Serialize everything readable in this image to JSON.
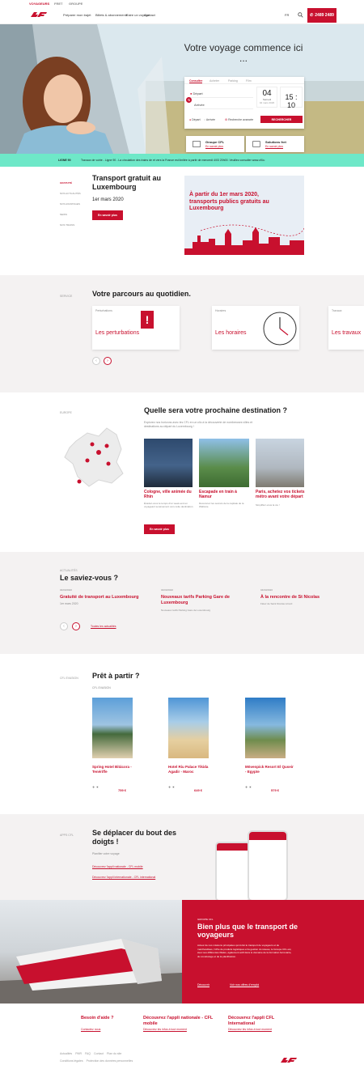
{
  "topbar": {
    "items": [
      "VOYAGEURS",
      "FRET",
      "GROUPE"
    ]
  },
  "nav": {
    "items": [
      "Préparer mon trajet",
      "Billets & abonnements",
      "Faire un voyage",
      "Entreprise",
      "Contact"
    ],
    "lang": "FR",
    "phone": "2489 2489"
  },
  "hero": {
    "title": "Votre voyage commence ici ...",
    "tabs": [
      "Consulter",
      "Acheter",
      "Parking",
      "Film"
    ],
    "from_placeholder": "Départ",
    "to_placeholder": "Arrivée",
    "day": "04",
    "weekday": "Samedi",
    "date_sub": "04 mars 2020",
    "time": "15 : 10",
    "options": [
      "Départ",
      "Arrivée",
      "Recherche avancée"
    ],
    "search_label": "RECHERCHER",
    "card1_title": "Groupe CFL",
    "card1_link": "En savoir plus",
    "card2_title": "Solutions fret",
    "card2_link": "En savoir plus"
  },
  "ticker": {
    "label": "LIGNE 90",
    "text": "Travaux de voirie - Ligne 90 - La circulation des trains de et vers la France est limitée à partir de mercredi 4/03 20h00. Veuillez consulter www.cfl.lu"
  },
  "news_tabs": [
    "GRATUITÉ",
    "NOS ACTUALITÉS",
    "NOS AVANTAGES",
    "NEWS",
    "NOS TRAINS"
  ],
  "featured": {
    "title": "Transport gratuit au Luxembourg",
    "date": "1er mars 2020",
    "button": "En savoir plus",
    "banner_text": "À partir du 1er mars 2020, transports publics gratuits au Luxembourg"
  },
  "parcours": {
    "label": "SERVICE",
    "title": "Votre parcours au quotidien.",
    "tiles": [
      {
        "tag": "Perturbations",
        "label": "Les perturbations"
      },
      {
        "tag": "Horaires",
        "label": "Les horaires"
      },
      {
        "tag": "Travaux",
        "label": "Les travaux"
      }
    ]
  },
  "destination": {
    "label": "EUROPE",
    "title": "Quelle sera votre prochaine destination ?",
    "intro": "Explorez nos horizons avec les CFL en un clic à la découverte de nombreuses villes et destinations au départ du Luxembourg !",
    "cards": [
      {
        "title": "Cologne, ville animée du Rhin",
        "desc": "Évadez-vous le temps d'un week-end en voyageant sereinement vers cette destination."
      },
      {
        "title": "Escapade en train à Namur",
        "desc": "Découvrez les secrets de la capitale de la Wallonie."
      },
      {
        "title": "Paris, achetez vos tickets métro avant votre départ",
        "desc": "Simplifiez-vous la vie !"
      }
    ],
    "button": "En savoir plus"
  },
  "saviez": {
    "label": "ACTUALITÉS",
    "title": "Le saviez-vous ?",
    "items": [
      {
        "date": "04/03/2020",
        "title": "Gratuité de transport au Luxembourg",
        "desc": "1er mars 2020"
      },
      {
        "date": "04/03/2020",
        "title": "Nouveaux tarifs Parking Gare de Luxembourg",
        "desc": "Nouveaux tarifs Parking Gare de Luxembourg"
      },
      {
        "date": "04/03/2020",
        "title": "À la rencontre de St Nicolas",
        "desc": "Fêtez de Saint Nicolas à bord"
      }
    ],
    "all_link": "Toutes les actualités"
  },
  "pret": {
    "label": "CFL EVASION",
    "title": "Prêt à partir ?",
    "sub": "CFL EVASION",
    "hotels": [
      {
        "title": "Spring Hotel Bitácora - Tenériffe",
        "price": "759 €"
      },
      {
        "title": "Hotel Riu Palace Tikida Agadir - Maroc",
        "price": "649 €"
      },
      {
        "title": "Mövenpick Resort El Quseir - Egypte",
        "price": "579 €"
      }
    ]
  },
  "app": {
    "label": "APPS CFL",
    "title": "Se déplacer du bout des doigts !",
    "sub": "Planifier votre voyage",
    "link1": "Découvrez l'appli nationale - CFL mobile",
    "link2": "Découvrez l'appli internationale - CFL international"
  },
  "groupe": {
    "label": "GROUPE CFL",
    "title": "Bien plus que le transport de voyageurs",
    "text": "Acteur de nos missions principales qui inclut le transport de voyageurs et de marchandises, l'offre de produits logistiques et la gestion du réseau, le Groupe CFL est, avec ses différentes filiales, également actif dans le domaine de la formation ferroviaire, du covoiturage et de la planification.",
    "link1": "Découvrir",
    "link2": "Voir nos offres d'emploi"
  },
  "footer": {
    "cols": [
      {
        "title": "Besoin d'aide ?",
        "link": "Contactez nous"
      },
      {
        "title": "Découvrez l'appli nationale - CFL mobile",
        "link": "Découvrez les infos à tout moment"
      },
      {
        "title": "Découvrez l'appli CFL International",
        "link": "Découvrez les infos à tout moment"
      }
    ],
    "links1": [
      "Actualités",
      "PMR",
      "FAQ",
      "Contact",
      "Plan du site"
    ],
    "links2": [
      "Conditions légales",
      "Protection des données personnelles"
    ]
  },
  "colors": {
    "brand": "#c8102e",
    "ticker": "#6ee8c8",
    "gray_bg": "#f4f2f2"
  }
}
